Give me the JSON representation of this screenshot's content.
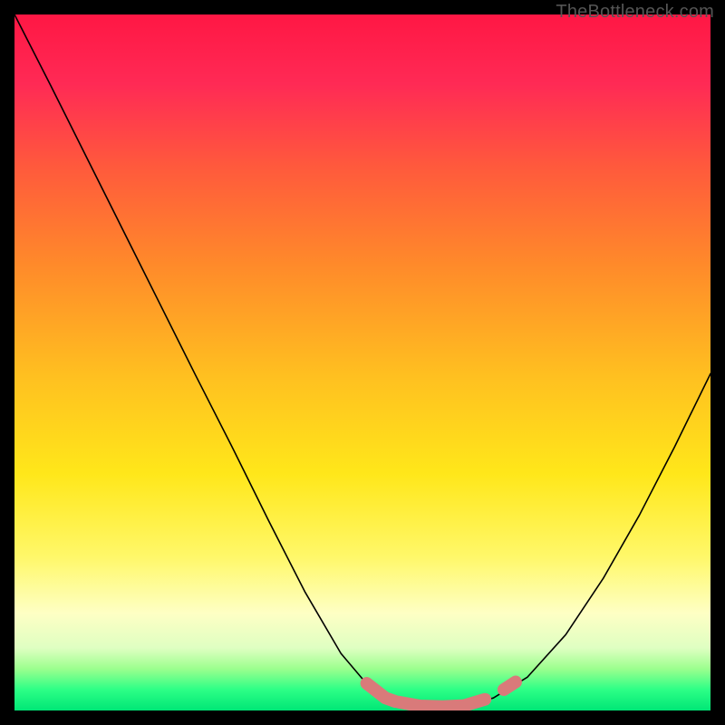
{
  "attribution": "TheBottleneck.com",
  "chart_data": {
    "type": "line",
    "title": "",
    "xlabel": "",
    "ylabel": "",
    "xlim": [
      0,
      100
    ],
    "ylim": [
      0,
      100
    ],
    "grid": false,
    "legend": false,
    "series": [
      {
        "name": "curve",
        "x": [
          0.0,
          5.2,
          10.4,
          15.6,
          20.8,
          26.0,
          31.3,
          36.5,
          41.7,
          46.9,
          50.8,
          53.4,
          57.3,
          60.9,
          64.8,
          68.8,
          73.7,
          79.2,
          84.6,
          89.8,
          94.8,
          100.0
        ],
        "y": [
          100.0,
          89.8,
          79.4,
          69.0,
          58.6,
          48.2,
          37.8,
          27.3,
          17.1,
          8.2,
          3.6,
          1.7,
          0.7,
          0.5,
          0.7,
          1.8,
          4.8,
          10.9,
          19.0,
          28.1,
          37.8,
          48.4
        ]
      },
      {
        "name": "optimal-marker-left",
        "x": [
          50.6,
          53.3,
          54.7
        ],
        "y": [
          3.9,
          1.8,
          1.3
        ]
      },
      {
        "name": "optimal-marker-flat",
        "x": [
          55.2,
          58.3,
          61.5,
          64.6,
          67.6
        ],
        "y": [
          1.2,
          0.65,
          0.55,
          0.7,
          1.6
        ]
      },
      {
        "name": "optimal-marker-right",
        "x": [
          70.3,
          72.0
        ],
        "y": [
          3.0,
          4.1
        ]
      }
    ]
  }
}
